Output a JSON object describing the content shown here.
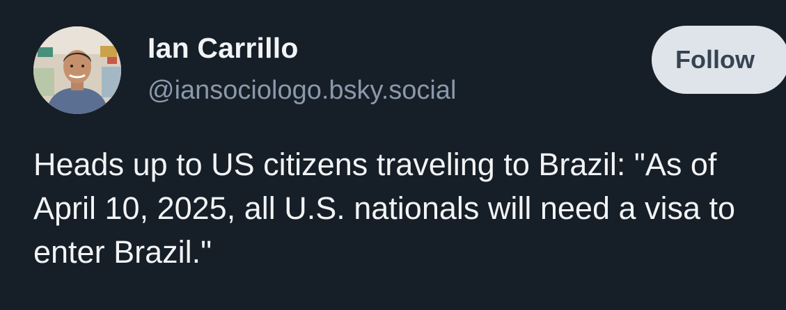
{
  "post": {
    "author": {
      "display_name": "Ian Carrillo",
      "handle": "@iansociologo.bsky.social",
      "avatar_icon": "user-photo-avatar"
    },
    "follow_label": "Follow",
    "text": "Heads up to US citizens traveling to Brazil: \"As of April 10, 2025, all U.S. nationals will need a visa to enter Brazil.\""
  },
  "colors": {
    "background": "#161e27",
    "text": "#f1f3f5",
    "handle": "#8a99aa",
    "follow_button_bg": "#dfe4ea",
    "follow_button_text": "#364352"
  }
}
